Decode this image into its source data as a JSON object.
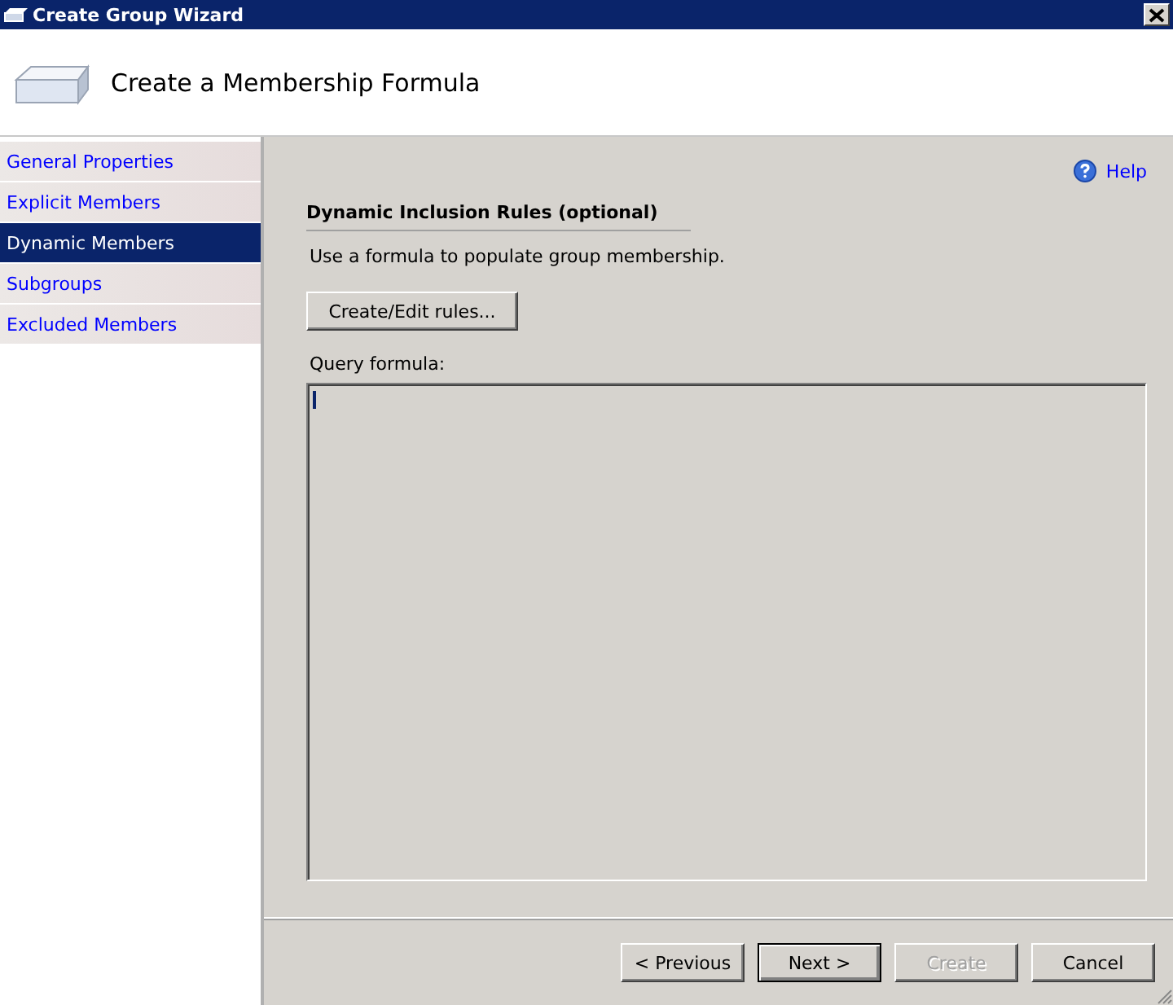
{
  "window": {
    "title": "Create Group Wizard"
  },
  "header": {
    "title": "Create a Membership Formula"
  },
  "sidebar": {
    "items": [
      {
        "label": "General Properties",
        "selected": false
      },
      {
        "label": "Explicit Members",
        "selected": false
      },
      {
        "label": "Dynamic Members",
        "selected": true
      },
      {
        "label": "Subgroups",
        "selected": false
      },
      {
        "label": "Excluded Members",
        "selected": false
      }
    ]
  },
  "help": {
    "label": "Help"
  },
  "section": {
    "title": "Dynamic Inclusion Rules (optional)",
    "description": "Use a formula to populate group membership.",
    "button": "Create/Edit rules...",
    "field_label": "Query formula:"
  },
  "buttons": [
    {
      "label": "< Previous",
      "disabled": false,
      "default": false
    },
    {
      "label": "Next >",
      "disabled": false,
      "default": true
    },
    {
      "label": "Create",
      "disabled": true,
      "default": false
    },
    {
      "label": "Cancel",
      "disabled": false,
      "default": false
    }
  ]
}
